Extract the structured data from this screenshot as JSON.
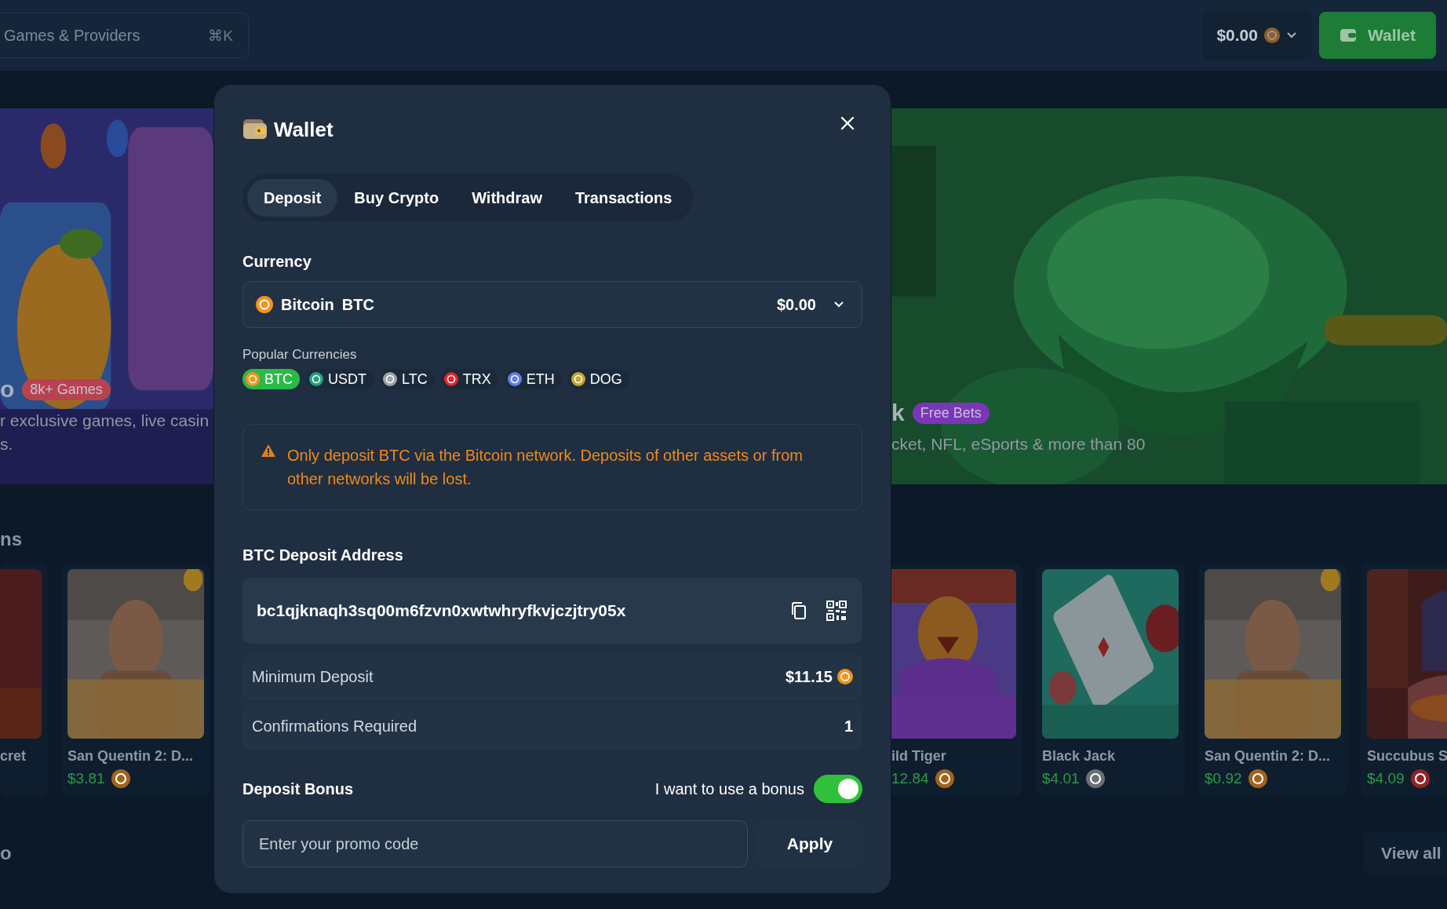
{
  "topbar": {
    "search": {
      "placeholder": "Games & Providers",
      "shortcut": "⌘K"
    },
    "balance": {
      "amount": "$0.00"
    },
    "wallet_button": {
      "label": "Wallet"
    }
  },
  "banners": [
    {
      "title": "o",
      "badge": "8k+ Games",
      "color": "#b8424e",
      "description": "r exclusive games, live casin\ns."
    },
    {
      "title": "k",
      "badge": "Free Bets",
      "color": "#7b35b8",
      "description": "cket, NFL, eSports & more than 80"
    }
  ],
  "section": {
    "title": "ns"
  },
  "games_left": [
    {
      "name": "cret"
    },
    {
      "name": "San Quentin 2: D...",
      "price": "$3.81",
      "color": "#a2631c"
    }
  ],
  "games_right": [
    {
      "name": "ild Tiger",
      "price": "12.84",
      "color": "#a2631c"
    },
    {
      "name": "Black Jack",
      "price": "$4.01",
      "color": "#6b7076"
    },
    {
      "name": "San Quentin 2: D...",
      "price": "$0.92",
      "color": "#a2631c"
    },
    {
      "name": "Succubus S",
      "price": "$4.09",
      "color": "#962226"
    }
  ],
  "next_section": {
    "title": "o",
    "view_all": "View all"
  },
  "modal": {
    "title": "Wallet",
    "tabs": [
      {
        "label": "Deposit",
        "selected": true
      },
      {
        "label": "Buy Crypto",
        "selected": false
      },
      {
        "label": "Withdraw",
        "selected": false
      },
      {
        "label": "Transactions",
        "selected": false
      }
    ],
    "currency": {
      "label": "Currency",
      "name": "Bitcoin",
      "code": "BTC",
      "amount": "$0.00"
    },
    "popular": {
      "label": "Popular Currencies",
      "items": [
        {
          "code": "BTC",
          "color": "#f7931a",
          "selected": true
        },
        {
          "code": "USDT",
          "color": "#26a17b",
          "selected": false
        },
        {
          "code": "LTC",
          "color": "#9ea3a8",
          "selected": false
        },
        {
          "code": "TRX",
          "color": "#e0262c",
          "selected": false
        },
        {
          "code": "ETH",
          "color": "#627eea",
          "selected": false
        },
        {
          "code": "DOG",
          "color": "#c2a633",
          "selected": false
        }
      ]
    },
    "warning": "Only deposit BTC via the Bitcoin network. Deposits of other assets or from other networks will be lost.",
    "address": {
      "label": "BTC Deposit Address",
      "value": "bc1qjknaqh3sq00m6fzvn0xwtwhryfkvjczjtry05x"
    },
    "details": [
      {
        "label": "Minimum Deposit",
        "value": "$11.15",
        "color": "#f7931a"
      },
      {
        "label": "Confirmations Required",
        "value": "1"
      }
    ],
    "bonus": {
      "title": "Deposit Bonus",
      "toggle_label": "I want to use a bonus",
      "on": true,
      "promo": {
        "placeholder": "Enter your promo code"
      },
      "apply": "Apply"
    }
  }
}
